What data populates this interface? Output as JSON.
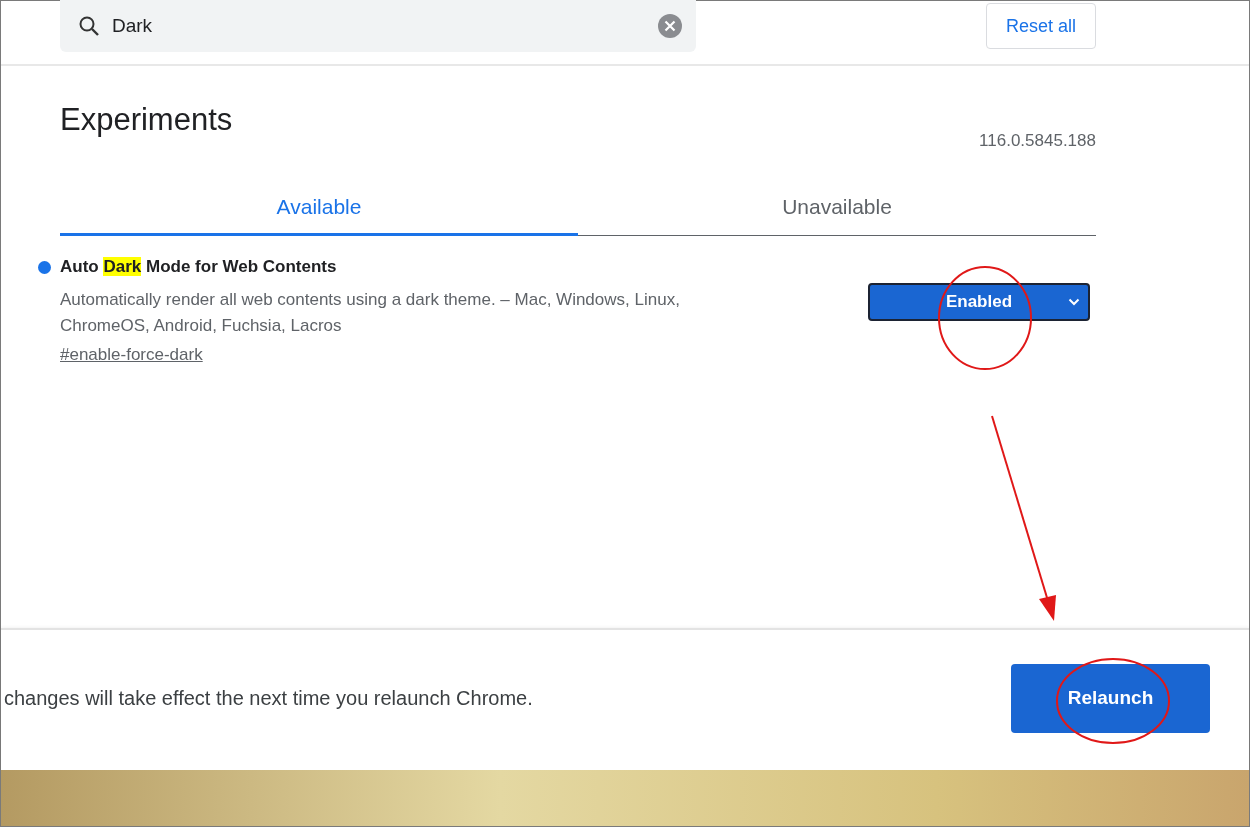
{
  "search": {
    "value": "Dark"
  },
  "reset_button": "Reset all",
  "page_title": "Experiments",
  "version": "116.0.5845.188",
  "tabs": [
    {
      "label": "Available",
      "selected": true
    },
    {
      "label": "Unavailable",
      "selected": false
    }
  ],
  "experiments": [
    {
      "title_parts": [
        {
          "text": "Auto ",
          "highlighted": false
        },
        {
          "text": "Dark",
          "highlighted": true
        },
        {
          "text": " Mode for Web Contents",
          "highlighted": false
        }
      ],
      "description": "Automatically render all web contents using a dark theme. – Mac, Windows, Linux, ChromeOS, Android, Fuchsia, Lacros",
      "link": "#enable-force-dark",
      "select_value": "Enabled",
      "modified": true
    }
  ],
  "footer": {
    "message": "changes will take effect the next time you relaunch Chrome.",
    "button": "Relaunch"
  }
}
